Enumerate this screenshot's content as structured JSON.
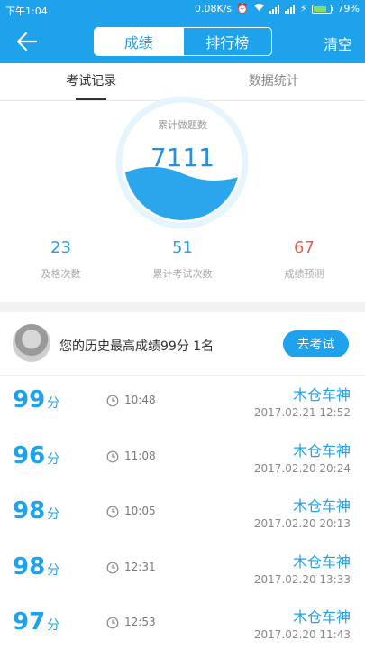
{
  "status_bar": {
    "time": "下午1:04",
    "network": "0.08K/s",
    "battery": "79%",
    "battery_level": 0.79
  },
  "nav": {
    "segments": [
      "成绩",
      "排行榜"
    ],
    "right_action": "清空"
  },
  "tabs": [
    "考试记录",
    "数据统计"
  ],
  "gauge": {
    "label": "累计做题数",
    "value": "7111"
  },
  "stats": [
    {
      "value": "23",
      "label": "及格次数",
      "color": "#2aa2e0"
    },
    {
      "value": "51",
      "label": "累计考试次数",
      "color": "#2aa2e0"
    },
    {
      "value": "67",
      "label": "成绩预测",
      "color": "#e0604f"
    }
  ],
  "best": {
    "text": "您的历史最高成绩99分  1名",
    "button": "去考试"
  },
  "records": [
    {
      "score": "99",
      "unit": "分",
      "duration": "10:48",
      "name": "木仓车神",
      "date": "2017.02.21  12:52"
    },
    {
      "score": "96",
      "unit": "分",
      "duration": "11:08",
      "name": "木仓车神",
      "date": "2017.02.20  20:24"
    },
    {
      "score": "98",
      "unit": "分",
      "duration": "10:05",
      "name": "木仓车神",
      "date": "2017.02.20  20:13"
    },
    {
      "score": "98",
      "unit": "分",
      "duration": "12:31",
      "name": "木仓车神",
      "date": "2017.02.20  13:33"
    },
    {
      "score": "97",
      "unit": "分",
      "duration": "12:53",
      "name": "木仓车神",
      "date": "2017.02.20  11:43"
    }
  ],
  "colors": {
    "primary": "#1ea2ec",
    "prediction": "#e0604f"
  }
}
